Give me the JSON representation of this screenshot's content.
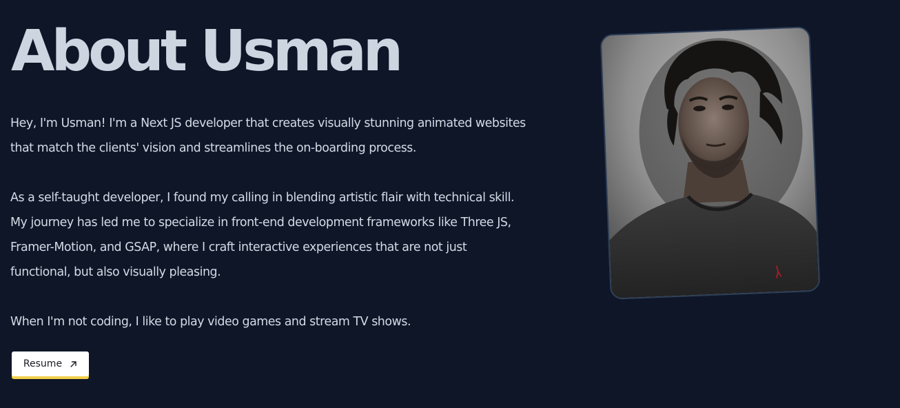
{
  "about": {
    "title": "About Usman",
    "paragraphs": [
      {
        "lines": [
          "Hey, I'm Usman! I'm a Next JS developer that creates visually stunning animated websites",
          "that match the clients' vision and streamlines the on-boarding process."
        ]
      },
      {
        "lines": [
          "As a self-taught developer, I found my calling in blending artistic flair with technical skill.",
          "My journey has led me to specialize in front-end development frameworks like Three JS,",
          "Framer-Motion, and GSAP, where I craft interactive experiences that are not just",
          "functional, but also visually pleasing."
        ]
      },
      {
        "lines": [
          "When I'm not coding, I like to play video games and stream TV shows."
        ]
      }
    ],
    "resume_button": {
      "label": "Resume",
      "icon": "arrow-up-right-icon"
    },
    "photo": {
      "alt": "Portrait photo"
    }
  },
  "colors": {
    "background": "#0f1628",
    "title": "#cdd5e1",
    "body_text": "#d3dbe6",
    "button_bg": "#ffffff",
    "button_accent": "#f2cf4a",
    "card_border": "#2c3d57"
  }
}
